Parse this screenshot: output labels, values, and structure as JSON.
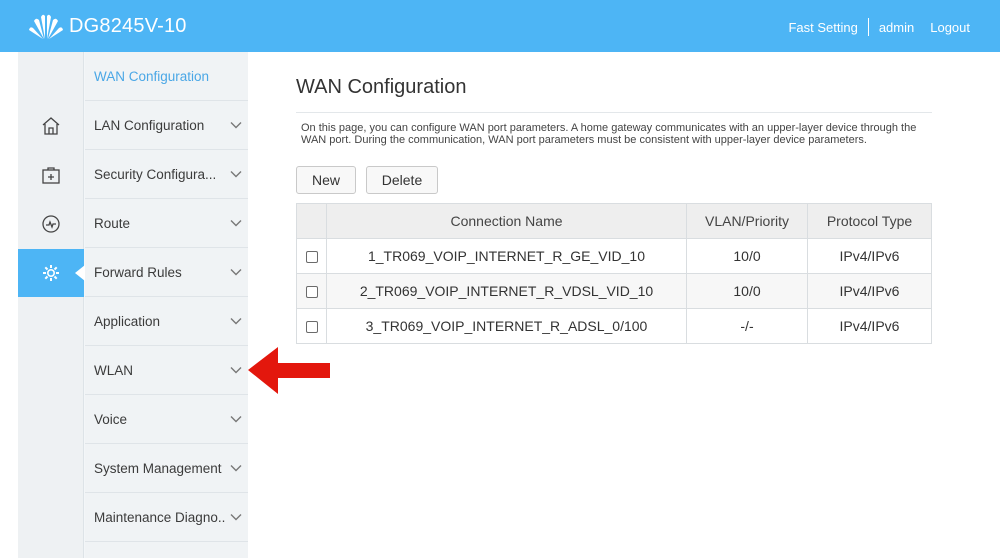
{
  "header": {
    "title": "DG8245V-10",
    "fast_setting": "Fast Setting",
    "user": "admin",
    "logout": "Logout",
    "bar_color": "#4db5f5"
  },
  "iconbar": {
    "items": [
      {
        "icon": "home-icon",
        "active": false
      },
      {
        "icon": "toolbox-icon",
        "active": false
      },
      {
        "icon": "gauge-icon",
        "active": false
      },
      {
        "icon": "gear-icon",
        "active": true
      }
    ]
  },
  "sidebar": {
    "items": [
      {
        "label": "WAN Configuration",
        "active": true
      },
      {
        "label": "LAN Configuration"
      },
      {
        "label": "Security Configura..."
      },
      {
        "label": "Route"
      },
      {
        "label": "Forward Rules"
      },
      {
        "label": "Application"
      },
      {
        "label": "WLAN"
      },
      {
        "label": "Voice"
      },
      {
        "label": "System Management"
      },
      {
        "label": "Maintenance Diagno.."
      }
    ]
  },
  "main": {
    "title": "WAN Configuration",
    "description": "On this page, you can configure WAN port parameters. A home gateway communicates with an upper-layer device through the WAN port. During the communication, WAN port parameters must be consistent with upper-layer device parameters.",
    "new_label": "New",
    "delete_label": "Delete",
    "table": {
      "headers": [
        "Connection Name",
        "VLAN/Priority",
        "Protocol Type"
      ],
      "rows": [
        {
          "name": "1_TR069_VOIP_INTERNET_R_GE_VID_10",
          "vlan": "10/0",
          "protocol": "IPv4/IPv6",
          "checked": false
        },
        {
          "name": "2_TR069_VOIP_INTERNET_R_VDSL_VID_10",
          "vlan": "10/0",
          "protocol": "IPv4/IPv6",
          "checked": false
        },
        {
          "name": "3_TR069_VOIP_INTERNET_R_ADSL_0/100",
          "vlan": "-/-",
          "protocol": "IPv4/IPv6",
          "checked": false
        }
      ]
    }
  },
  "annotation": {
    "icon": "red-arrow-icon",
    "color": "#e3170d"
  }
}
